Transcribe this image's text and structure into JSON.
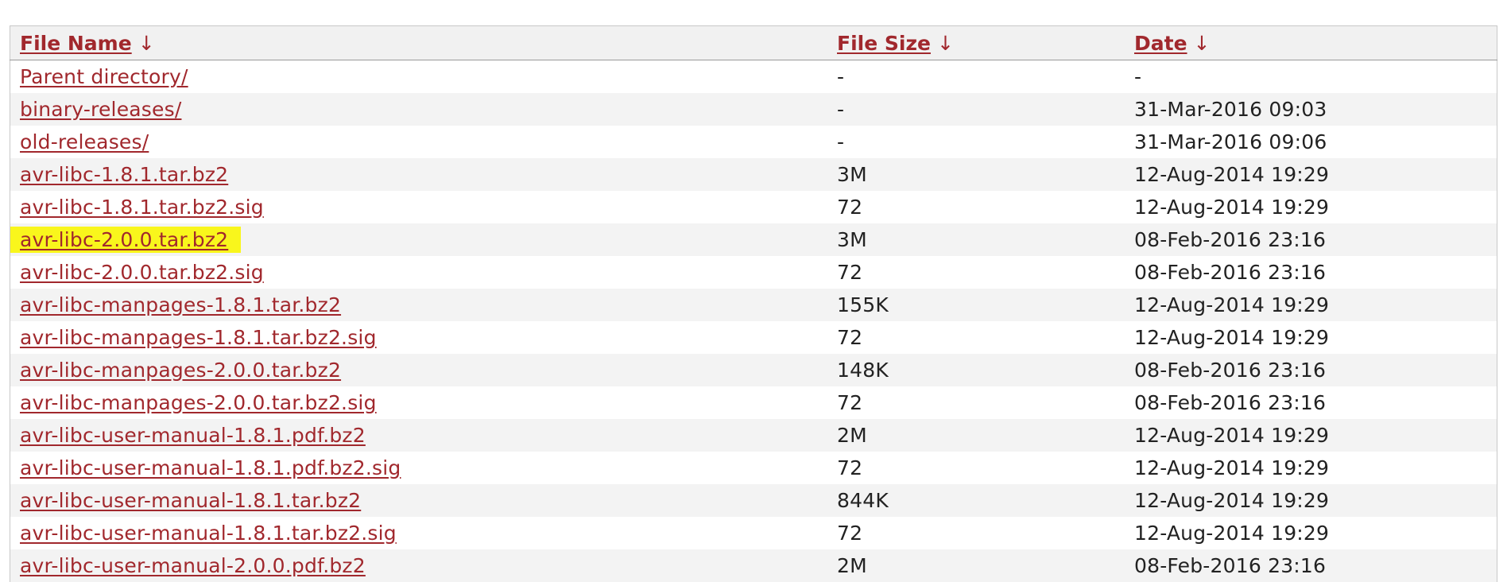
{
  "table": {
    "headers": {
      "name": "File Name",
      "size": "File Size",
      "date": "Date",
      "sort_arrow": "↓"
    },
    "highlight_color": "#f9f61c",
    "link_color": "#a1282d",
    "rows": [
      {
        "name": "Parent directory/",
        "size": "-",
        "date": "-"
      },
      {
        "name": "binary-releases/",
        "size": "-",
        "date": "31-Mar-2016 09:03"
      },
      {
        "name": "old-releases/",
        "size": "-",
        "date": "31-Mar-2016 09:06"
      },
      {
        "name": "avr-libc-1.8.1.tar.bz2",
        "size": "3M",
        "date": "12-Aug-2014 19:29"
      },
      {
        "name": "avr-libc-1.8.1.tar.bz2.sig",
        "size": "72",
        "date": "12-Aug-2014 19:29"
      },
      {
        "name": "avr-libc-2.0.0.tar.bz2",
        "size": "3M",
        "date": "08-Feb-2016 23:16",
        "highlighted": true
      },
      {
        "name": "avr-libc-2.0.0.tar.bz2.sig",
        "size": "72",
        "date": "08-Feb-2016 23:16"
      },
      {
        "name": "avr-libc-manpages-1.8.1.tar.bz2",
        "size": "155K",
        "date": "12-Aug-2014 19:29"
      },
      {
        "name": "avr-libc-manpages-1.8.1.tar.bz2.sig",
        "size": "72",
        "date": "12-Aug-2014 19:29"
      },
      {
        "name": "avr-libc-manpages-2.0.0.tar.bz2",
        "size": "148K",
        "date": "08-Feb-2016 23:16"
      },
      {
        "name": "avr-libc-manpages-2.0.0.tar.bz2.sig",
        "size": "72",
        "date": "08-Feb-2016 23:16"
      },
      {
        "name": "avr-libc-user-manual-1.8.1.pdf.bz2",
        "size": "2M",
        "date": "12-Aug-2014 19:29"
      },
      {
        "name": "avr-libc-user-manual-1.8.1.pdf.bz2.sig",
        "size": "72",
        "date": "12-Aug-2014 19:29"
      },
      {
        "name": "avr-libc-user-manual-1.8.1.tar.bz2",
        "size": "844K",
        "date": "12-Aug-2014 19:29"
      },
      {
        "name": "avr-libc-user-manual-1.8.1.tar.bz2.sig",
        "size": "72",
        "date": "12-Aug-2014 19:29"
      },
      {
        "name": "avr-libc-user-manual-2.0.0.pdf.bz2",
        "size": "2M",
        "date": "08-Feb-2016 23:16"
      }
    ]
  }
}
